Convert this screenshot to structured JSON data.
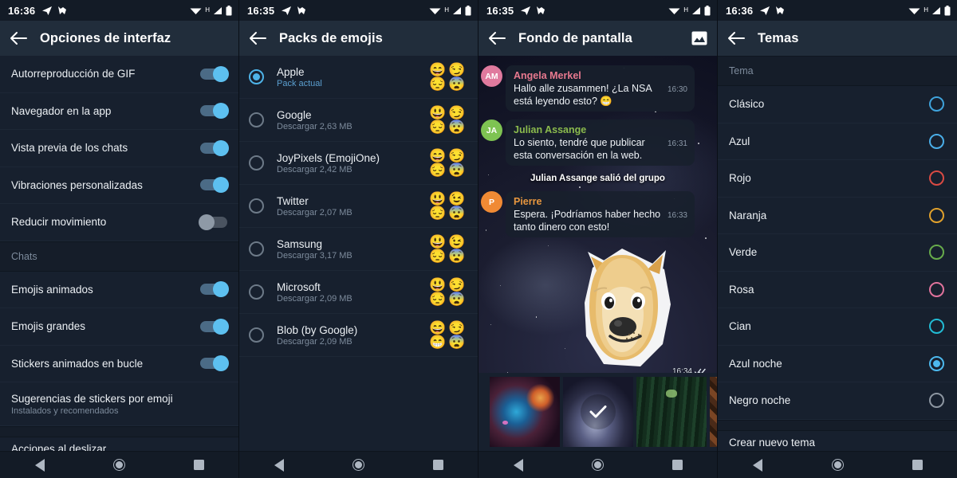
{
  "statusbar": {
    "time_1": "16:36",
    "time_2": "16:35",
    "time_3": "16:35",
    "time_4": "16:36",
    "icons": [
      "telegram-icon",
      "dog-icon",
      "wifi-icon",
      "signal-h-icon",
      "battery-icon"
    ],
    "network_label": "H"
  },
  "screen1": {
    "title": "Opciones de interfaz",
    "rows": [
      {
        "label": "Autorreproducción de GIF",
        "toggle": "on"
      },
      {
        "label": "Navegador en la app",
        "toggle": "on"
      },
      {
        "label": "Vista previa de los chats",
        "toggle": "on"
      },
      {
        "label": "Vibraciones personalizadas",
        "toggle": "on"
      },
      {
        "label": "Reducir movimiento",
        "toggle": "off"
      }
    ],
    "section_chats": "Chats",
    "rows2": [
      {
        "label": "Emojis animados",
        "toggle": "on"
      },
      {
        "label": "Emojis grandes",
        "toggle": "on"
      },
      {
        "label": "Stickers animados en bucle",
        "toggle": "on"
      }
    ],
    "sticker_suggestions": {
      "title": "Sugerencias de stickers por emoji",
      "subtitle": "Instalados y recomendados"
    },
    "cut_row": "Acciones al deslizar"
  },
  "screen2": {
    "title": "Packs de emojis",
    "packs": [
      {
        "name": "Apple",
        "sub": "Pack actual",
        "selected": true,
        "emojis": [
          "😄",
          "😏",
          "😔",
          "😨"
        ]
      },
      {
        "name": "Google",
        "sub": "Descargar 2,63 MB",
        "selected": false,
        "emojis": [
          "😃",
          "😏",
          "😔",
          "😨"
        ]
      },
      {
        "name": "JoyPixels (EmojiOne)",
        "sub": "Descargar 2,42 MB",
        "selected": false,
        "emojis": [
          "😄",
          "😏",
          "😔",
          "😨"
        ]
      },
      {
        "name": "Twitter",
        "sub": "Descargar 2,07 MB",
        "selected": false,
        "emojis": [
          "😃",
          "😉",
          "😔",
          "😨"
        ]
      },
      {
        "name": "Samsung",
        "sub": "Descargar 3,17 MB",
        "selected": false,
        "emojis": [
          "😃",
          "😉",
          "😔",
          "😨"
        ]
      },
      {
        "name": "Microsoft",
        "sub": "Descargar 2,09 MB",
        "selected": false,
        "emojis": [
          "😃",
          "😏",
          "😔",
          "😨"
        ]
      },
      {
        "name": "Blob (by Google)",
        "sub": "Descargar 2,09 MB",
        "selected": false,
        "emojis": [
          "😄",
          "😏",
          "😁",
          "😨"
        ]
      }
    ]
  },
  "screen3": {
    "title": "Fondo de pantalla",
    "action_icon": "gallery-icon",
    "messages": [
      {
        "initials": "AM",
        "avatar_color": "#e07a9e",
        "name": "Angela Merkel",
        "name_color": "#e8798f",
        "text": "Hallo alle zusammen! ¿La NSA está leyendo esto? 😁",
        "time": "16:30"
      },
      {
        "initials": "JA",
        "avatar_color": "#7ec352",
        "name": "Julian Assange",
        "name_color": "#8bbb4d",
        "text": "Lo siento, tendré que publicar esta conversación en la web.",
        "time": "16:31"
      },
      {
        "initials": "P",
        "avatar_color": "#f08a34",
        "name": "Pierre",
        "name_color": "#e8973f",
        "text": "Espera. ¡Podríamos haber hecho tanto dinero con esto!",
        "time": "16:33"
      }
    ],
    "system_message": "Julian Assange salió del grupo",
    "sticker": "doge-sticker",
    "sticker_time": "16:34",
    "sticker_status": "double-check-icon",
    "wallpapers": [
      {
        "name": "nebula-thumb",
        "selected": false
      },
      {
        "name": "galaxy-thumb",
        "selected": true
      },
      {
        "name": "forest-thumb",
        "selected": false
      },
      {
        "name": "coffee-thumb",
        "selected": false
      }
    ]
  },
  "screen4": {
    "title": "Temas",
    "section_label": "Tema",
    "themes": [
      {
        "label": "Clásico",
        "color": "#3fa3dc",
        "selected": false
      },
      {
        "label": "Azul",
        "color": "#4aaee8",
        "selected": false
      },
      {
        "label": "Rojo",
        "color": "#d94a43",
        "selected": false
      },
      {
        "label": "Naranja",
        "color": "#e0a02c",
        "selected": false
      },
      {
        "label": "Verde",
        "color": "#67ab4b",
        "selected": false
      },
      {
        "label": "Rosa",
        "color": "#e0739c",
        "selected": false
      },
      {
        "label": "Cian",
        "color": "#22bbd4",
        "selected": false
      },
      {
        "label": "Azul noche",
        "color": "#4db9ee",
        "selected": true
      },
      {
        "label": "Negro noche",
        "color": "#8d96a1",
        "selected": false
      }
    ],
    "cut_row": "Crear nuevo tema"
  },
  "navbar": {
    "back": "back-nav-icon",
    "home": "home-nav-icon",
    "recents": "recents-nav-icon"
  }
}
